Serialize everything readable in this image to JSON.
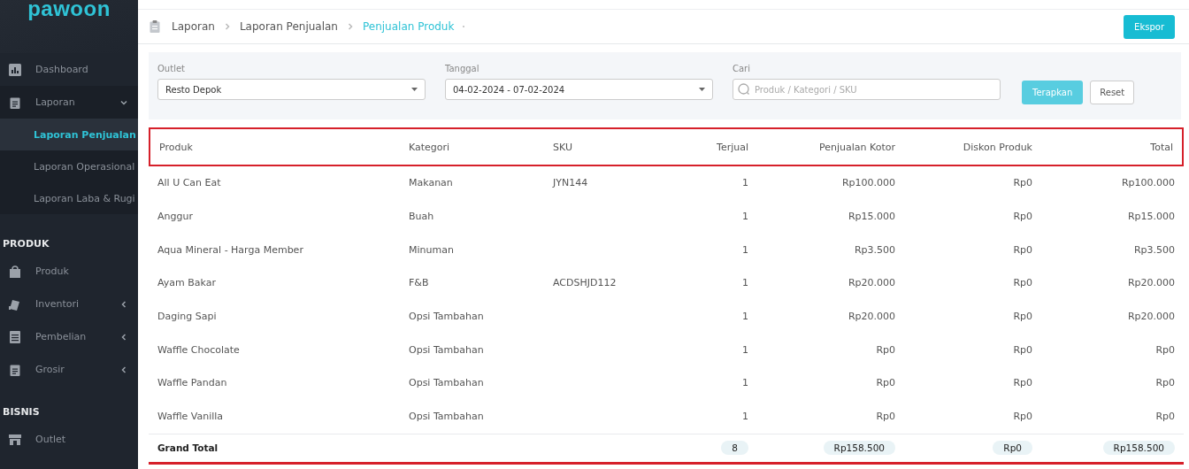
{
  "sidebar": {
    "logo": "pawoon",
    "items": [
      {
        "kind": "item",
        "label": "Dashboard"
      },
      {
        "kind": "item",
        "label": "Laporan",
        "expanded": true,
        "children": [
          {
            "label": "Laporan Penjualan",
            "selected": true
          },
          {
            "label": "Laporan Operasional",
            "selected": false
          },
          {
            "label": "Laporan Laba & Rugi",
            "selected": false
          }
        ]
      },
      {
        "kind": "section",
        "label": "PRODUK"
      },
      {
        "kind": "item",
        "label": "Produk"
      },
      {
        "kind": "item",
        "label": "Inventori",
        "expanded": false
      },
      {
        "kind": "item",
        "label": "Pembelian",
        "expanded": false
      },
      {
        "kind": "item",
        "label": "Grosir",
        "expanded": false
      },
      {
        "kind": "section",
        "label": "BISNIS"
      },
      {
        "kind": "item",
        "label": "Outlet"
      }
    ]
  },
  "breadcrumb": [
    "Laporan",
    "Laporan Penjualan",
    "Penjualan Produk"
  ],
  "export_button": "Ekspor",
  "filters": {
    "outlet": {
      "label": "Outlet",
      "value": "Resto Depok"
    },
    "date": {
      "label": "Tanggal",
      "value": "04-02-2024 - 07-02-2024"
    },
    "search": {
      "label": "Cari",
      "placeholder": "Produk / Kategori / SKU"
    },
    "apply_button": "Terapkan",
    "reset_button": "Reset"
  },
  "table": {
    "header_highlighted": true,
    "columns": [
      {
        "label": "Produk"
      },
      {
        "label": "Kategori"
      },
      {
        "label": "SKU"
      },
      {
        "label": "Terjual"
      },
      {
        "label": "Penjualan Kotor"
      },
      {
        "label": "Diskon Produk"
      },
      {
        "label": "Total"
      }
    ],
    "rows": [
      [
        "All U Can Eat",
        "Makanan",
        "JYN144",
        "1",
        "Rp100.000",
        "Rp0",
        "Rp100.000"
      ],
      [
        "Anggur",
        "Buah",
        "",
        "1",
        "Rp15.000",
        "Rp0",
        "Rp15.000"
      ],
      [
        "Aqua Mineral - Harga Member",
        "Minuman",
        "",
        "1",
        "Rp3.500",
        "Rp0",
        "Rp3.500"
      ],
      [
        "Ayam Bakar",
        "F&B",
        "ACDSHJD112",
        "1",
        "Rp20.000",
        "Rp0",
        "Rp20.000"
      ],
      [
        "Daging Sapi",
        "Opsi Tambahan",
        "",
        "1",
        "Rp20.000",
        "Rp0",
        "Rp20.000"
      ],
      [
        "Waffle Chocolate",
        "Opsi Tambahan",
        "",
        "1",
        "Rp0",
        "Rp0",
        "Rp0"
      ],
      [
        "Waffle Pandan",
        "Opsi Tambahan",
        "",
        "1",
        "Rp0",
        "Rp0",
        "Rp0"
      ],
      [
        "Waffle Vanilla",
        "Opsi Tambahan",
        "",
        "1",
        "Rp0",
        "Rp0",
        "Rp0"
      ]
    ],
    "grand_total": {
      "label": "Grand Total",
      "underlined": true,
      "values": [
        "8",
        "Rp158.500",
        "Rp0",
        "Rp158.500"
      ]
    }
  }
}
